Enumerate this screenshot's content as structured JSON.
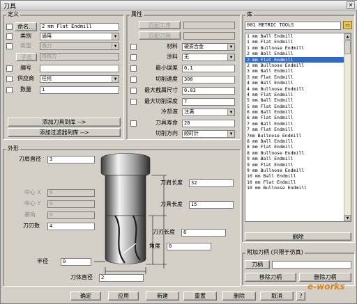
{
  "window": {
    "title": "刀具"
  },
  "define": {
    "legend": "定义",
    "name_btn": "命名...",
    "name_value": "2 mm Flat Endmill",
    "category_label": "类别",
    "category_value": "通用",
    "type_label": "类型",
    "type_value": "铣刀",
    "subtype_label": "子类",
    "subtype_value": "铣铣刀",
    "number_label": "编号",
    "number_value": "",
    "supplier_label": "供应商",
    "supplier_value": "任何",
    "quantity_label": "数量",
    "quantity_value": "1",
    "add_tool_btn": "添加刀具到库 -->",
    "add_filter_btn": "添加过滤器到库 -->"
  },
  "props": {
    "legend": "属性",
    "holder_btn": "匹配工序",
    "holder_value": "",
    "match_btn": "匹配刀具",
    "match_value": "",
    "material_label": "材料",
    "material_value": "硬质合金",
    "coating_label": "涂料",
    "coating_value": "无",
    "min_error_label": "最小误差",
    "min_error_value": "0.1",
    "cut_rate_label": "切削速度",
    "cut_rate_value": "300",
    "max_cut_label": "最大截屑尺寸",
    "max_cut_value": "0.03",
    "max_depth_label": "最大切削深度",
    "max_depth_value": "7",
    "coolant_label": "冷却液",
    "coolant_value": "注满",
    "life_label": "刀具寿命",
    "life_value": "20",
    "direction_label": "切削方向",
    "direction_value": "顺时针"
  },
  "library": {
    "legend": "库",
    "selector": "001 METRIC TOOLS",
    "items": [
      "1 mm Ball Endmill",
      "1 mm Flat Endmill",
      "1 mm Bullnose Endmill",
      "2 mm Ball Endmill",
      "2 mm Flat Endmill",
      "2 mm Bullnose Endmill",
      "3 mm Ball Endmill",
      "3 mm Flat Endmill",
      "4 mm Ball Endmill",
      "4 mm Bullnose Endmill",
      "4 mm Flat Endmill",
      "5 mm Ball Endmill",
      "5 mm Flat Endmill",
      "6 mm Ball Endmill",
      "6 mm Flat Endmill",
      "7 mm Ball Endmill",
      "7 mm Flat Endmill",
      "7mm Bullnose Endmill",
      "8 mm Ball Endmill",
      "8 mm Flat Endmill",
      "8 mm Bullnose Endmill",
      "9 mm Ball Endmill",
      "9 mm Flat Endmill",
      "9 mm Bullnose Endmill",
      "10 mm Ball Endmill",
      "10 mm Flat Endmill",
      "10 mm Bullnose Endmill"
    ],
    "selected_index": 4,
    "delete_btn": "删除"
  },
  "holder": {
    "legend": "附加刀柄 (只限于仿真)",
    "holder_btn": "刀柄",
    "holder_value": "",
    "remove_btn": "移除刀柄",
    "delete_btn": "删除刀柄"
  },
  "shape": {
    "legend": "外形",
    "diameter_label": "刀肩直径",
    "diameter_value": "3",
    "center_x_label": "中心 X",
    "center_x_value": "0",
    "center_y_label": "中心 Y",
    "center_y_value": "0",
    "base_label": "基角",
    "base_value": "0",
    "flutes_label": "刀刃数",
    "flutes_value": "4",
    "tool_length_label": "刀肩长度",
    "tool_length_value": "32",
    "shank_length_label": "刀具长度",
    "shank_length_value": "15",
    "flute_length_label": "刀刃长度",
    "flute_length_value": "8",
    "angle_label": "角度",
    "angle_value": "0",
    "radius_label": "半径",
    "radius_value": "0",
    "body_diameter_label": "刀体直径",
    "body_diameter_value": "2"
  },
  "footer": {
    "ok": "确定",
    "apply": "应用",
    "new": "新建",
    "reset": "重置",
    "delete": "删除",
    "cancel": "取消",
    "help": "?"
  },
  "watermark": "e-works"
}
